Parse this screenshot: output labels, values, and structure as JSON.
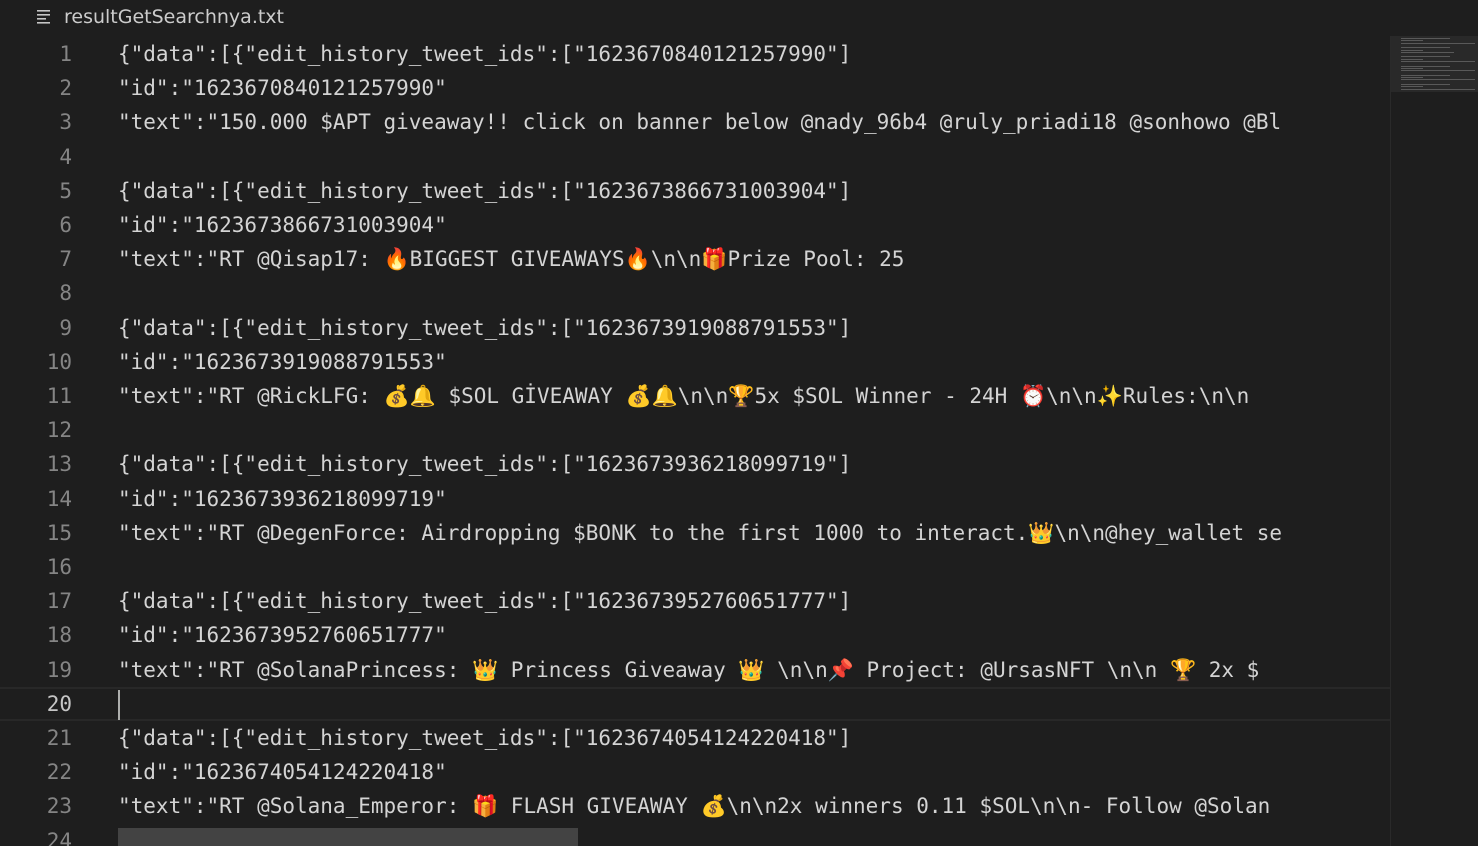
{
  "tab": {
    "title": "resultGetSearchnya.txt",
    "icon": "text-file-lines-icon"
  },
  "editor": {
    "current_line": 20,
    "lines": [
      {
        "n": "1",
        "text": "{\"data\":[{\"edit_history_tweet_ids\":[\"1623670840121257990\"]"
      },
      {
        "n": "2",
        "text": "\"id\":\"1623670840121257990\""
      },
      {
        "n": "3",
        "text": "\"text\":\"150.000 $APT giveaway!! click on banner below @nady_96b4 @ruly_priadi18 @sonhowo @Bl"
      },
      {
        "n": "4",
        "text": ""
      },
      {
        "n": "5",
        "text": "{\"data\":[{\"edit_history_tweet_ids\":[\"1623673866731003904\"]"
      },
      {
        "n": "6",
        "text": "\"id\":\"1623673866731003904\""
      },
      {
        "n": "7",
        "text": "\"text\":\"RT @Qisap17: 🔥BIGGEST GIVEAWAYS🔥\\n\\n🎁Prize Pool: 25"
      },
      {
        "n": "8",
        "text": ""
      },
      {
        "n": "9",
        "text": "{\"data\":[{\"edit_history_tweet_ids\":[\"1623673919088791553\"]"
      },
      {
        "n": "10",
        "text": "\"id\":\"1623673919088791553\""
      },
      {
        "n": "11",
        "text": "\"text\":\"RT @RickLFG: 💰🔔 $SOL GİVEAWAY 💰🔔\\n\\n🏆5x $SOL Winner - 24H ⏰\\n\\n✨Rules:\\n\\n"
      },
      {
        "n": "12",
        "text": ""
      },
      {
        "n": "13",
        "text": "{\"data\":[{\"edit_history_tweet_ids\":[\"1623673936218099719\"]"
      },
      {
        "n": "14",
        "text": "\"id\":\"1623673936218099719\""
      },
      {
        "n": "15",
        "text": "\"text\":\"RT @DegenForce: Airdropping $BONK to the first 1000 to interact.👑\\n\\n@hey_wallet se"
      },
      {
        "n": "16",
        "text": ""
      },
      {
        "n": "17",
        "text": "{\"data\":[{\"edit_history_tweet_ids\":[\"1623673952760651777\"]"
      },
      {
        "n": "18",
        "text": "\"id\":\"1623673952760651777\""
      },
      {
        "n": "19",
        "text": "\"text\":\"RT @SolanaPrincess: 👑 Princess Giveaway 👑 \\n\\n📌 Project: @UrsasNFT \\n\\n 🏆 2x $"
      },
      {
        "n": "20",
        "text": ""
      },
      {
        "n": "21",
        "text": "{\"data\":[{\"edit_history_tweet_ids\":[\"1623674054124220418\"]"
      },
      {
        "n": "22",
        "text": "\"id\":\"1623674054124220418\""
      },
      {
        "n": "23",
        "text": "\"text\":\"RT @Solana_Emperor: 🎁 FLASH GIVEAWAY 💰\\n\\n2x winners 0.11 $SOL\\n\\n- Follow @Solan"
      },
      {
        "n": "24",
        "text": ""
      }
    ]
  },
  "colors": {
    "background": "#1e1e1e",
    "text": "#d4d4d4",
    "line_number": "#858585",
    "line_number_active": "#c6c6c6"
  }
}
